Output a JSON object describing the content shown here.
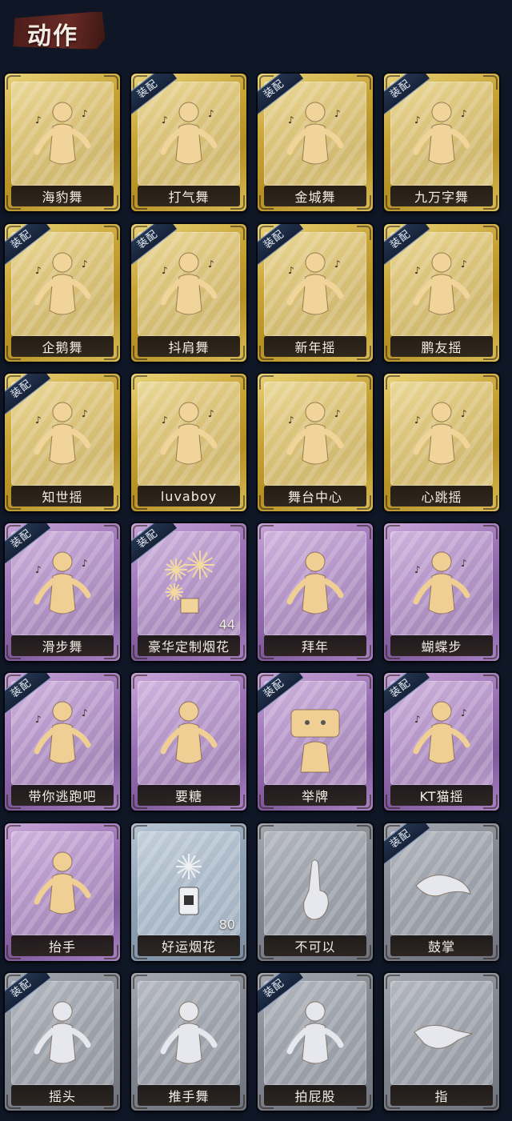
{
  "header": {
    "title": "动作"
  },
  "equip_label": "装配",
  "cards": [
    {
      "name": "海豹舞",
      "tier": "gold",
      "equipped": false,
      "icon": "dancer-icon",
      "count": ""
    },
    {
      "name": "打气舞",
      "tier": "gold",
      "equipped": true,
      "icon": "dancer-icon",
      "count": ""
    },
    {
      "name": "金城舞",
      "tier": "gold",
      "equipped": true,
      "icon": "dancer-icon",
      "count": ""
    },
    {
      "name": "九万字舞",
      "tier": "gold",
      "equipped": true,
      "icon": "dancer-icon",
      "count": ""
    },
    {
      "name": "企鹅舞",
      "tier": "gold",
      "equipped": true,
      "icon": "dancer-icon",
      "count": ""
    },
    {
      "name": "抖肩舞",
      "tier": "gold",
      "equipped": true,
      "icon": "dancer-icon",
      "count": ""
    },
    {
      "name": "新年摇",
      "tier": "gold",
      "equipped": true,
      "icon": "dancer-icon",
      "count": ""
    },
    {
      "name": "鹏友摇",
      "tier": "gold",
      "equipped": true,
      "icon": "dancer-icon",
      "count": ""
    },
    {
      "name": "知世摇",
      "tier": "gold",
      "equipped": true,
      "icon": "dancer-icon",
      "count": ""
    },
    {
      "name": "luvaboy",
      "tier": "gold",
      "equipped": false,
      "icon": "dancer-icon",
      "count": ""
    },
    {
      "name": "舞台中心",
      "tier": "gold",
      "equipped": false,
      "icon": "dancer-icon",
      "count": ""
    },
    {
      "name": "心跳摇",
      "tier": "gold",
      "equipped": false,
      "icon": "dancer-icon",
      "count": ""
    },
    {
      "name": "滑步舞",
      "tier": "purple",
      "equipped": true,
      "icon": "dancer-icon",
      "count": ""
    },
    {
      "name": "豪华定制烟花",
      "tier": "purple",
      "equipped": true,
      "icon": "fireworks-icon",
      "count": "44"
    },
    {
      "name": "拜年",
      "tier": "purple",
      "equipped": false,
      "icon": "bow-icon",
      "count": ""
    },
    {
      "name": "蝴蝶步",
      "tier": "purple",
      "equipped": false,
      "icon": "dancer-icon",
      "count": ""
    },
    {
      "name": "带你逃跑吧",
      "tier": "purple",
      "equipped": true,
      "icon": "dancer-icon",
      "count": ""
    },
    {
      "name": "要糖",
      "tier": "purple",
      "equipped": false,
      "icon": "figure-icon",
      "count": ""
    },
    {
      "name": "举牌",
      "tier": "purple",
      "equipped": true,
      "icon": "sign-icon",
      "count": ""
    },
    {
      "name": "KT猫摇",
      "tier": "purple",
      "equipped": true,
      "icon": "dancer-icon",
      "count": ""
    },
    {
      "name": "抬手",
      "tier": "purple",
      "equipped": false,
      "icon": "figure-icon",
      "count": ""
    },
    {
      "name": "好运烟花",
      "tier": "blue",
      "equipped": false,
      "icon": "firecracker-icon",
      "count": "80"
    },
    {
      "name": "不可以",
      "tier": "grey",
      "equipped": false,
      "icon": "finger-icon",
      "count": ""
    },
    {
      "name": "鼓掌",
      "tier": "grey",
      "equipped": true,
      "icon": "clap-icon",
      "count": ""
    },
    {
      "name": "摇头",
      "tier": "grey",
      "equipped": true,
      "icon": "figure-icon",
      "count": ""
    },
    {
      "name": "推手舞",
      "tier": "grey",
      "equipped": false,
      "icon": "figure-icon",
      "count": ""
    },
    {
      "name": "拍屁股",
      "tier": "grey",
      "equipped": true,
      "icon": "figure-icon",
      "count": ""
    },
    {
      "name": "指",
      "tier": "grey",
      "equipped": false,
      "icon": "point-icon",
      "count": ""
    }
  ]
}
